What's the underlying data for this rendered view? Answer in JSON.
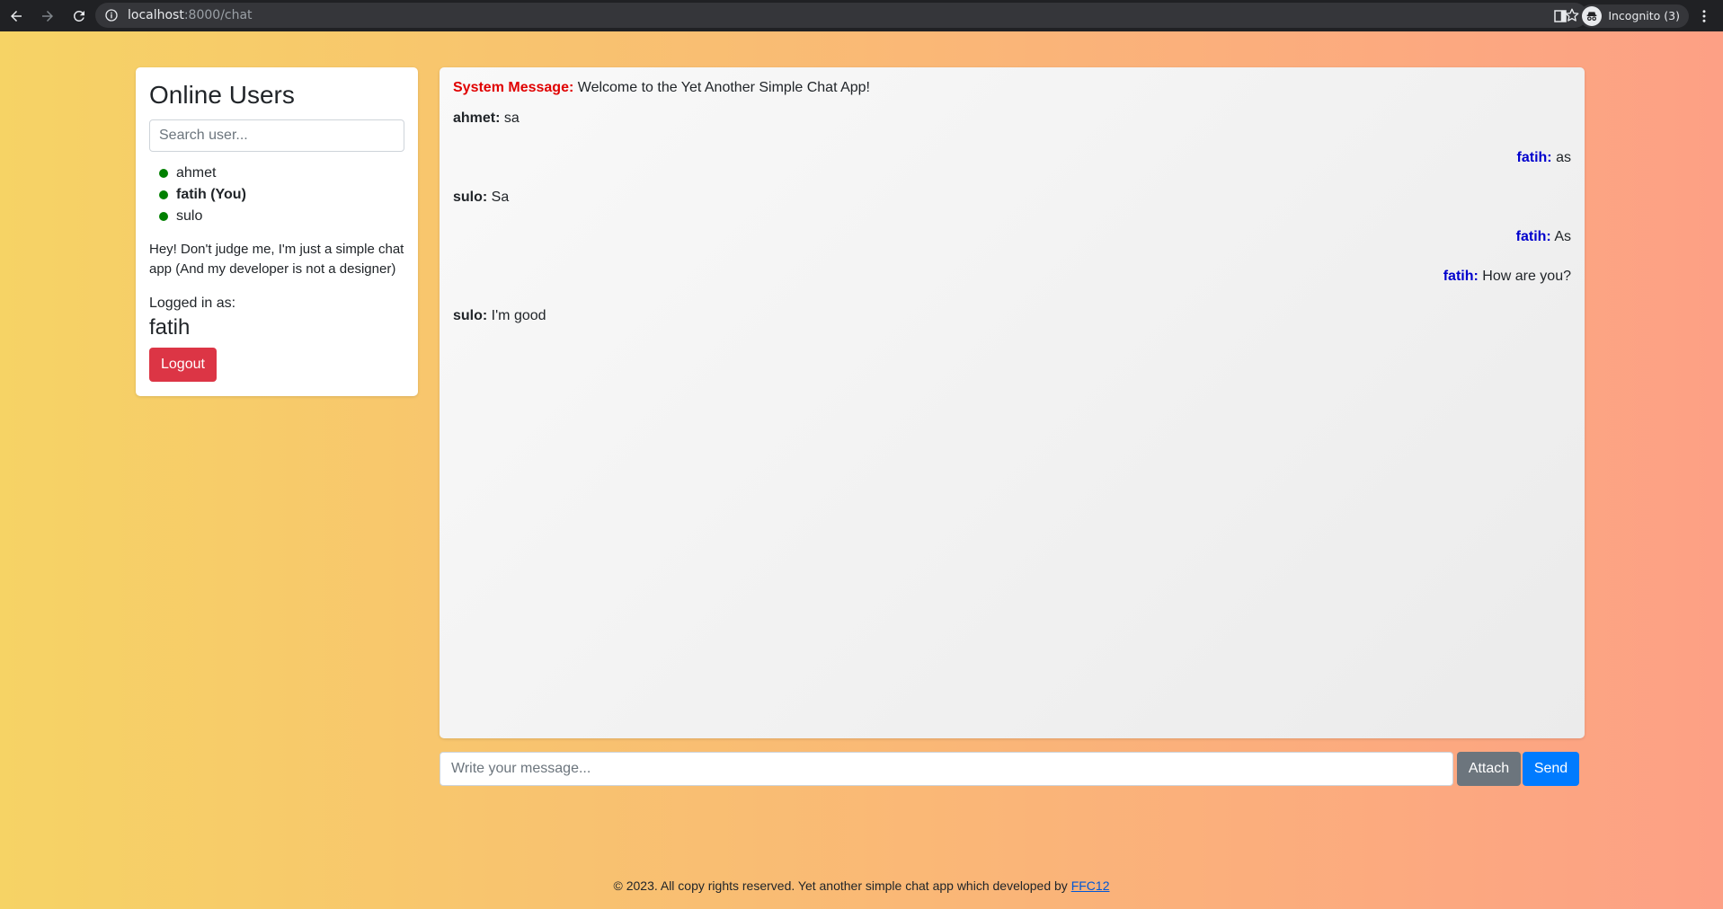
{
  "browser": {
    "url_host": "localhost",
    "url_path": ":8000/chat",
    "incognito_label": "Incognito (3)"
  },
  "sidebar": {
    "title": "Online Users",
    "search_placeholder": "Search user...",
    "users": [
      {
        "name": "ahmet",
        "status_color": "#008000"
      },
      {
        "name": "fatih (You)",
        "status_color": "#008000"
      },
      {
        "name": "sulo",
        "status_color": "#008000"
      }
    ],
    "note": "Hey! Don't judge me, I'm just a simple chat app (And my developer is not a designer)",
    "logged_in_label": "Logged in as:",
    "logged_in_user": "fatih",
    "logout_label": "Logout"
  },
  "chat": {
    "messages": [
      {
        "sender": "System Message:",
        "text": "Welcome to the Yet Another Simple Chat App!"
      },
      {
        "sender": "ahmet:",
        "text": "sa"
      },
      {
        "sender": "fatih:",
        "text": "as"
      },
      {
        "sender": "sulo:",
        "text": "Sa"
      },
      {
        "sender": "fatih:",
        "text": "As"
      },
      {
        "sender": "fatih:",
        "text": "How are you?"
      },
      {
        "sender": "sulo:",
        "text": "I'm good"
      }
    ]
  },
  "composer": {
    "placeholder": "Write your message...",
    "attach_label": "Attach",
    "send_label": "Send"
  },
  "footer": {
    "text": "© 2023. All copy rights reserved. Yet another simple chat app which developed by",
    "link_text": "FFC12"
  },
  "colors": {
    "gradient_start": "#f6d365",
    "gradient_end": "#fda085",
    "online": "#008000",
    "system_sender": "#e00000",
    "self_sender": "#0000cd",
    "logout": "#dc3545",
    "attach": "#6c757d",
    "send": "#007bff"
  }
}
